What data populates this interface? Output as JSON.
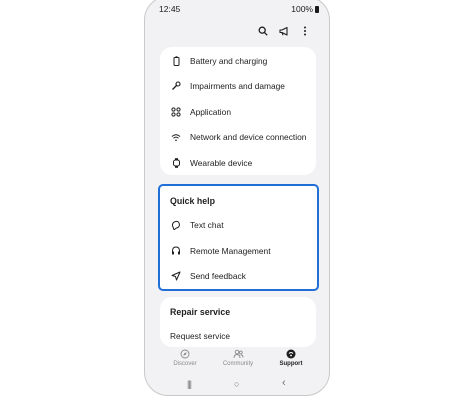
{
  "status": {
    "time": "12:45",
    "battery": "100%"
  },
  "topbar": {
    "icons": [
      "search-icon",
      "megaphone-icon",
      "more-vert-icon"
    ]
  },
  "devices": {
    "items": [
      {
        "label": "Battery and charging",
        "icon": "battery-icon"
      },
      {
        "label": "Impairments and damage",
        "icon": "wrench-icon"
      },
      {
        "label": "Application",
        "icon": "apps-icon"
      },
      {
        "label": "Network and device connection",
        "icon": "wifi-icon"
      },
      {
        "label": "Wearable device",
        "icon": "watch-icon"
      }
    ]
  },
  "quick_help": {
    "title": "Quick help",
    "items": [
      {
        "label": "Text chat",
        "icon": "chat-icon"
      },
      {
        "label": "Remote Management",
        "icon": "headset-icon"
      },
      {
        "label": "Send feedback",
        "icon": "send-icon"
      }
    ],
    "highlight_color": "#1f6fd6"
  },
  "repair": {
    "title": "Repair service",
    "item": "Request service"
  },
  "bottom_nav": [
    {
      "label": "Discover",
      "icon": "compass-icon",
      "active": false
    },
    {
      "label": "Community",
      "icon": "people-icon",
      "active": false
    },
    {
      "label": "Support",
      "icon": "support-icon",
      "active": true
    }
  ],
  "system_nav": {
    "recents": "|||",
    "home": "○",
    "back": "‹"
  }
}
